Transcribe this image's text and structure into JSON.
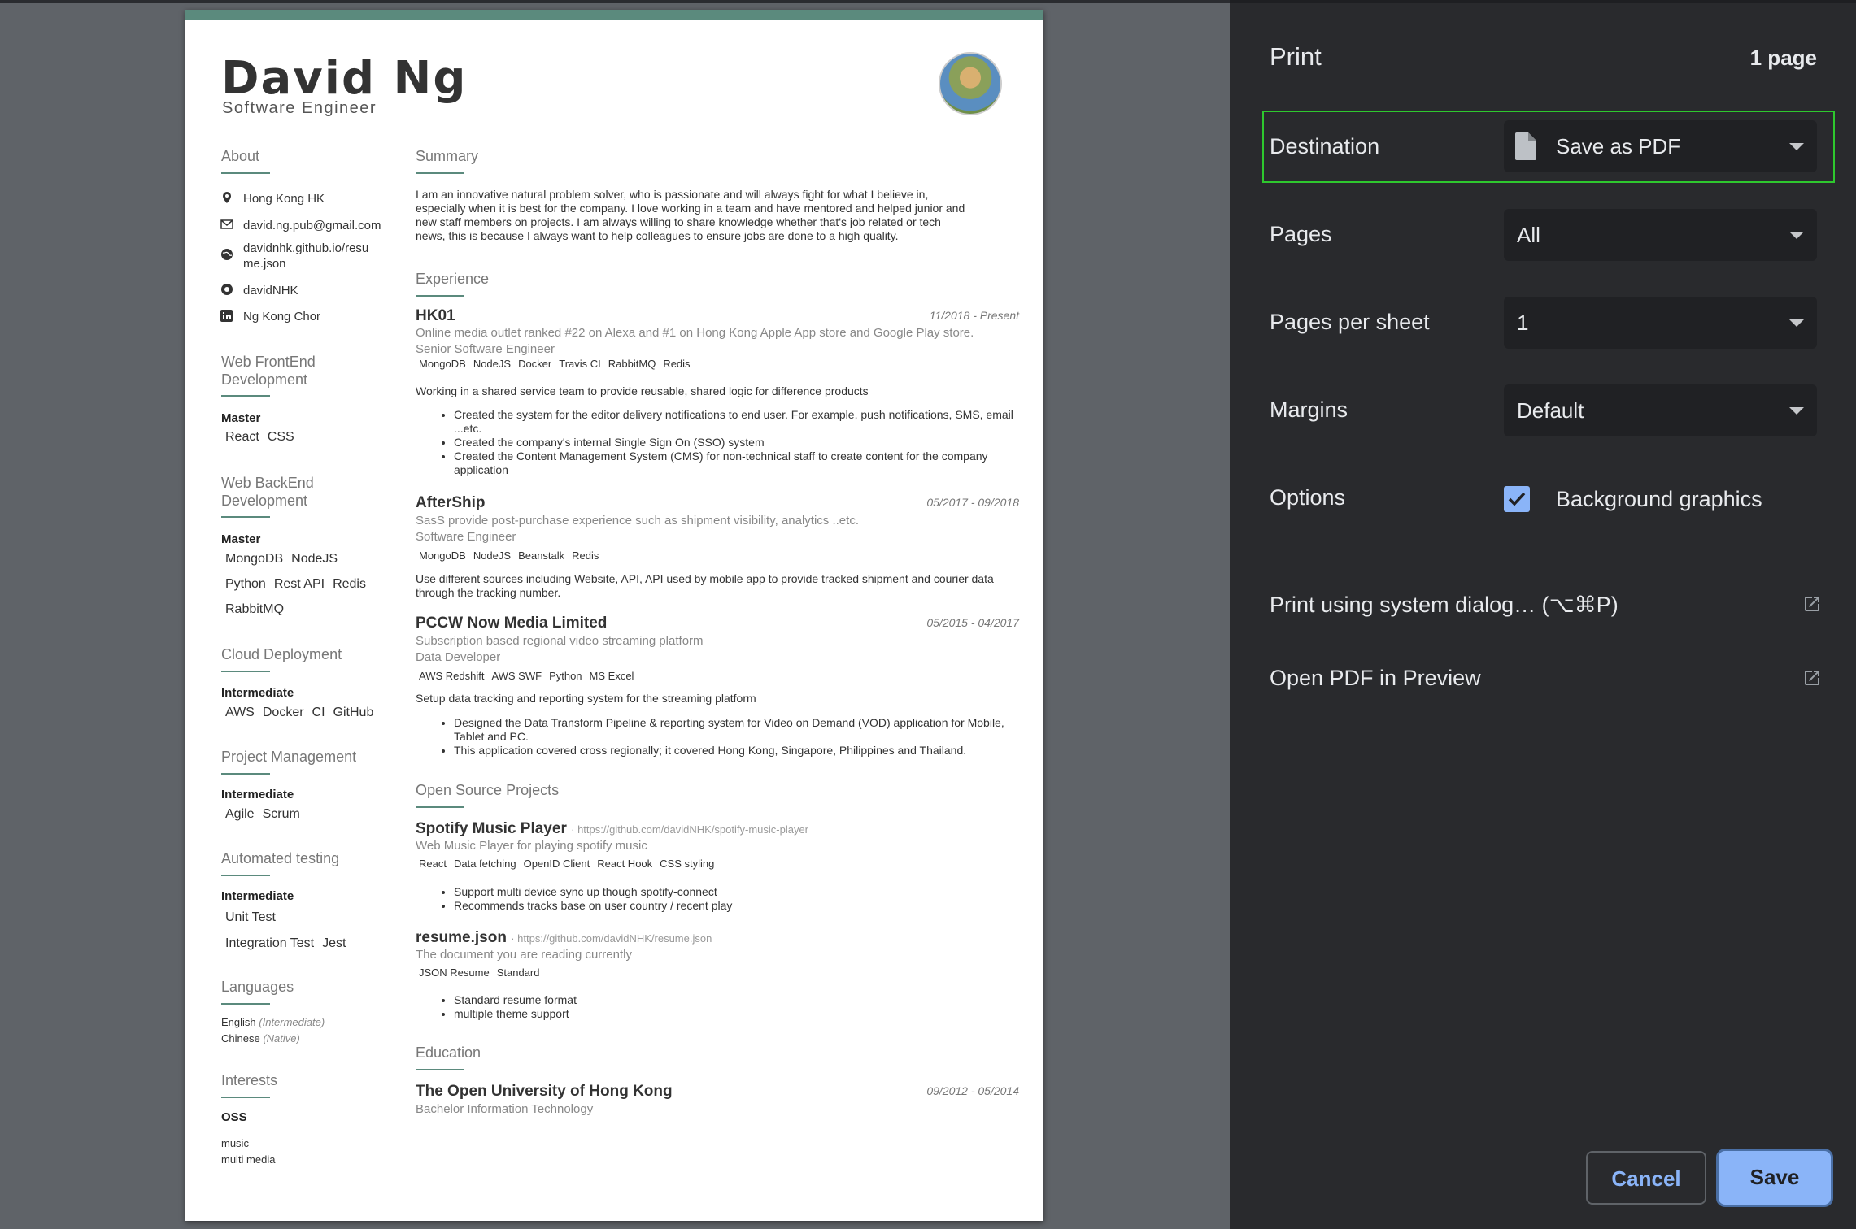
{
  "resume": {
    "name": "David Ng",
    "role": "Software Engineer",
    "about": {
      "heading": "About",
      "location": "Hong Kong HK",
      "email": "david.ng.pub@gmail.com",
      "website_1": "davidnhk.github.io/resu",
      "website_2": "me.json",
      "github": "davidNHK",
      "linkedin": "Ng Kong Chor"
    },
    "skills": [
      {
        "h1": "Web FrontEnd",
        "h2": "Development",
        "level": "Master",
        "rows": [
          [
            "React",
            "CSS"
          ]
        ]
      },
      {
        "h1": "Web BackEnd",
        "h2": "Development",
        "level": "Master",
        "rows": [
          [
            "MongoDB",
            "NodeJS"
          ],
          [
            "Python",
            "Rest API",
            "Redis"
          ],
          [
            "RabbitMQ"
          ]
        ]
      },
      {
        "h1": "Cloud Deployment",
        "h2": "",
        "level": "Intermediate",
        "rows": [
          [
            "AWS",
            "Docker",
            "CI",
            "GitHub"
          ]
        ]
      },
      {
        "h1": "Project Management",
        "h2": "",
        "level": "Intermediate",
        "rows": [
          [
            "Agile",
            "Scrum"
          ]
        ]
      },
      {
        "h1": "Automated testing",
        "h2": "",
        "level": "Intermediate",
        "rows": [
          [
            "Unit Test"
          ],
          [
            "Integration Test",
            "Jest"
          ]
        ]
      }
    ],
    "languages": {
      "heading": "Languages",
      "items": [
        {
          "lang": "English",
          "level": "(Intermediate)"
        },
        {
          "lang": "Chinese",
          "level": "(Native)"
        }
      ]
    },
    "interests": {
      "heading": "Interests",
      "name": "OSS",
      "items": [
        "music",
        "multi media"
      ]
    },
    "summary": {
      "heading": "Summary",
      "lines": [
        "I am an innovative natural problem solver, who is passionate and will always fight for what I believe in,",
        "especially when it is best for the company. I love working in a team and have mentored and helped junior and",
        "new staff members on projects. I am always willing to share knowledge whether that's job related or tech",
        "news, this is because I always want to help colleagues to ensure jobs are done to a high quality."
      ]
    },
    "experience": {
      "heading": "Experience",
      "jobs": [
        {
          "company": "HK01",
          "date": "11/2018 - Present",
          "desc": "Online media outlet ranked #22 on Alexa and #1 on Hong Kong Apple App store and Google Play store.",
          "position": "Senior Software Engineer",
          "tags": [
            "MongoDB",
            "NodeJS",
            "Docker",
            "Travis CI",
            "RabbitMQ",
            "Redis"
          ],
          "summary": "Working in a shared service team to provide reusable, shared logic for difference products",
          "bullets": [
            "Created the system for the editor delivery notifications to end user. For example, push notifications, SMS, email ...etc.",
            "Created the company's internal Single Sign On (SSO) system",
            "Created the Content Management System (CMS) for non-technical staff to create content for the company application"
          ]
        },
        {
          "company": "AfterShip",
          "date": "05/2017 - 09/2018",
          "desc": "SasS provide post-purchase experience such as shipment visibility, analytics ..etc.",
          "position": "Software Engineer",
          "tags": [
            "MongoDB",
            "NodeJS",
            "Beanstalk",
            "Redis"
          ],
          "summary": "Use different sources including Website, API, API used by mobile app to provide tracked shipment and courier data through the tracking number.",
          "bullets": []
        },
        {
          "company": "PCCW Now Media Limited",
          "date": "05/2015 - 04/2017",
          "desc": "Subscription based regional video streaming platform",
          "position": "Data Developer",
          "tags": [
            "AWS Redshift",
            "AWS SWF",
            "Python",
            "MS Excel"
          ],
          "summary": "Setup data tracking and reporting system for the streaming platform",
          "bullets": [
            "Designed the Data Transform Pipeline & reporting system for Video on Demand (VOD) application for Mobile, Tablet and PC.",
            "This application covered cross regionally; it covered Hong Kong, Singapore, Philippines and Thailand."
          ]
        }
      ]
    },
    "projects": {
      "heading": "Open Source Projects",
      "items": [
        {
          "name": "Spotify Music Player",
          "url": "· https://github.com/davidNHK/spotify-music-player",
          "desc": "Web Music Player for playing spotify music",
          "tags": [
            "React",
            "Data fetching",
            "OpenID Client",
            "React Hook",
            "CSS styling"
          ],
          "bullets": [
            "Support multi device sync up though spotify-connect",
            "Recommends tracks base on user country / recent play"
          ]
        },
        {
          "name": "resume.json",
          "url": "· https://github.com/davidNHK/resume.json",
          "desc": "The document you are reading currently",
          "tags": [
            "JSON Resume",
            "Standard"
          ],
          "bullets": [
            "Standard resume format",
            "multiple theme support"
          ]
        }
      ]
    },
    "education": {
      "heading": "Education",
      "school": "The Open University of Hong Kong",
      "date": "09/2012 - 05/2014",
      "degree": "Bachelor Information Technology"
    }
  },
  "print": {
    "title": "Print",
    "page_count": "1 page",
    "destination_label": "Destination",
    "destination_value": "Save as PDF",
    "pages_label": "Pages",
    "pages_value": "All",
    "pps_label": "Pages per sheet",
    "pps_value": "1",
    "margins_label": "Margins",
    "margins_value": "Default",
    "options_label": "Options",
    "bg_graphics_label": "Background graphics",
    "bg_graphics_checked": true,
    "system_dialog": "Print using system dialog… (⌥⌘P)",
    "open_preview": "Open PDF in Preview",
    "cancel": "Cancel",
    "save": "Save",
    "colors": {
      "accent": "#8ab4f8",
      "focus": "#2ec82e",
      "panel": "#292a2d"
    }
  }
}
